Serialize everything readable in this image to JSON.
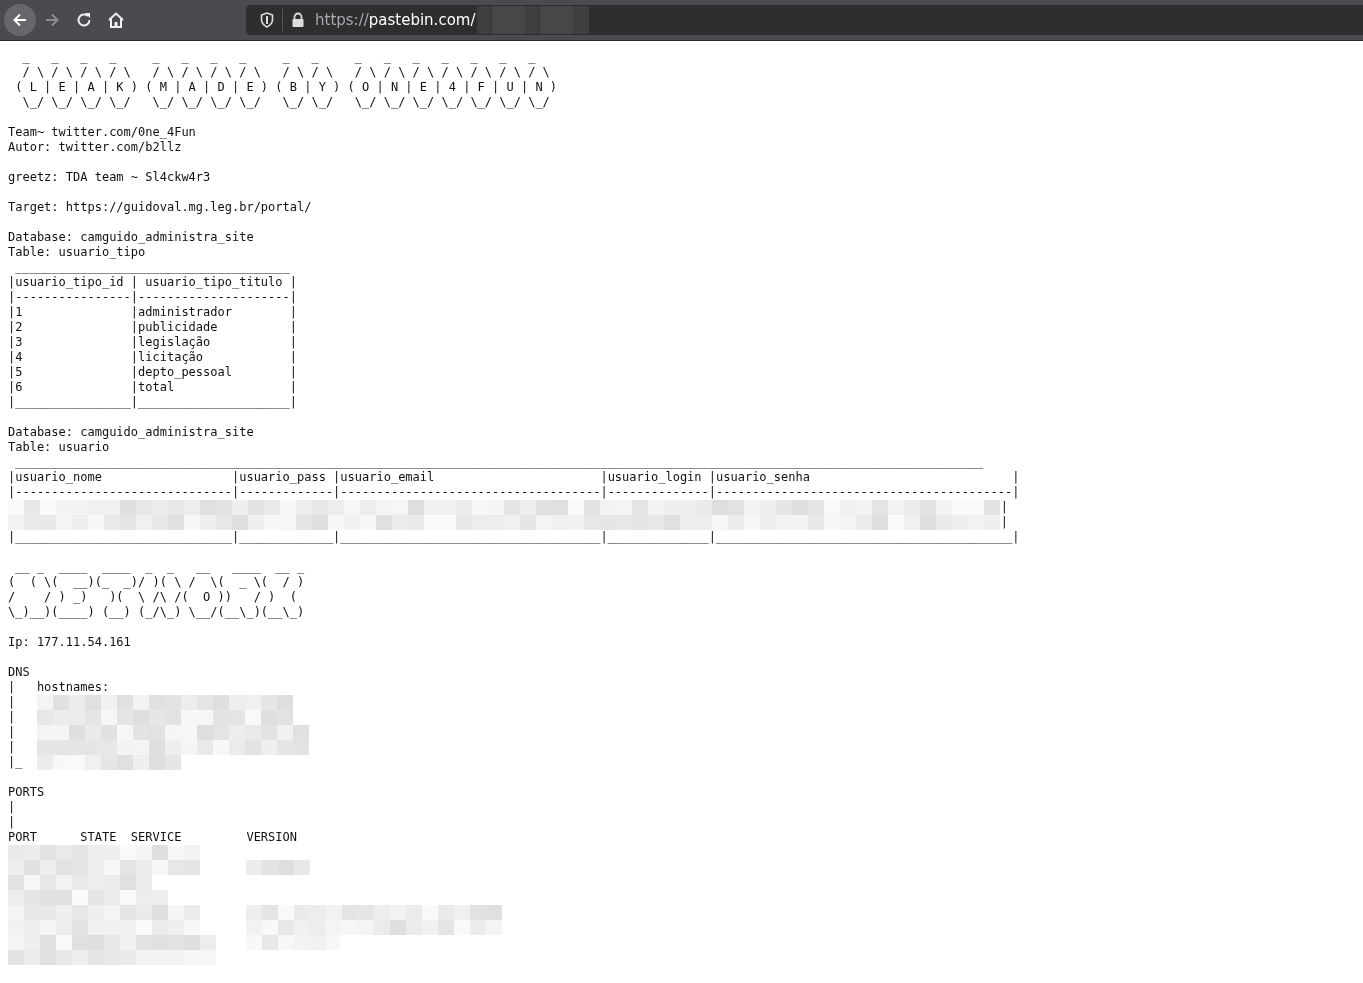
{
  "browser": {
    "url_scheme": "https://",
    "url_host": "pastebin.com/"
  },
  "lines": [
    {
      "kind": "art",
      "text": "  _   _   _   _     _   _   _   _     _   _     _   _   _   _   _   _   _"
    },
    {
      "kind": "art",
      "text": "  / \\ / \\ / \\ / \\   / \\ / \\ / \\ / \\   / \\ / \\   / \\ / \\ / \\ / \\ / \\ / \\ / \\"
    },
    {
      "kind": "art",
      "text": " ( L | E | A | K ) ( M | A | D | E ) ( B | Y ) ( O | N | E | 4 | F | U | N )"
    },
    {
      "kind": "art",
      "text": "  \\_/ \\_/ \\_/ \\_/   \\_/ \\_/ \\_/ \\_/   \\_/ \\_/   \\_/ \\_/ \\_/ \\_/ \\_/ \\_/ \\_/"
    },
    {
      "kind": "blank"
    },
    {
      "kind": "text",
      "text": "Team~ twitter.com/0ne_4Fun"
    },
    {
      "kind": "text",
      "text": "Autor: twitter.com/b2llz"
    },
    {
      "kind": "blank"
    },
    {
      "kind": "text",
      "text": "greetz: TDA team ~ Sl4ckw4r3"
    },
    {
      "kind": "blank"
    },
    {
      "kind": "text",
      "text": "Target: https://guidoval.mg.leg.br/portal/"
    },
    {
      "kind": "blank"
    },
    {
      "kind": "text",
      "text": "Database: camguido_administra_site"
    },
    {
      "kind": "text",
      "text": "Table: usuario_tipo"
    },
    {
      "kind": "text",
      "text": " ______________________________________"
    },
    {
      "kind": "text",
      "text": "|usuario_tipo_id | usuario_tipo_titulo |"
    },
    {
      "kind": "text",
      "text": "|----------------|---------------------|"
    },
    {
      "kind": "text",
      "text": "|1               |administrador        |"
    },
    {
      "kind": "text",
      "text": "|2               |publicidade          |"
    },
    {
      "kind": "text",
      "text": "|3               |legislação           |"
    },
    {
      "kind": "text",
      "text": "|4               |licitação            |"
    },
    {
      "kind": "text",
      "text": "|5               |depto_pessoal        |"
    },
    {
      "kind": "text",
      "text": "|6               |total                |"
    },
    {
      "kind": "text",
      "text": "|________________|_____________________|"
    },
    {
      "kind": "blank"
    },
    {
      "kind": "text",
      "text": "Database: camguido_administra_site"
    },
    {
      "kind": "text",
      "text": "Table: usuario"
    },
    {
      "kind": "text",
      "text": " ______________________________________________________________________________________________________________________________________"
    },
    {
      "kind": "text",
      "text": "|usuario_nome                  |usuario_pass |usuario_email                       |usuario_login |usuario_senha                            |"
    },
    {
      "kind": "text",
      "text": "|------------------------------|-------------|------------------------------------|--------------|-----------------------------------------|"
    },
    {
      "kind": "redacted",
      "suffix": "|"
    },
    {
      "kind": "redacted",
      "suffix": "|"
    },
    {
      "kind": "text",
      "text": "|______________________________|_____________|____________________________________|______________|_________________________________________|"
    },
    {
      "kind": "blank"
    },
    {
      "kind": "art",
      "text": " __ _  ____  ____  _  _   __   ____  __ _"
    },
    {
      "kind": "art",
      "text": "(  ( \\(  __)(_  _)/ )( \\ /  \\(  _ \\(  / )"
    },
    {
      "kind": "art",
      "text": "/    / ) _)   )(  \\ /\\ /(  O ))   / )  ("
    },
    {
      "kind": "art",
      "text": "\\_)__)(____) (__) (_/\\_) \\__/(__\\_)(__\\_)"
    },
    {
      "kind": "blank"
    },
    {
      "kind": "text",
      "text": "Ip: 177.11.54.161"
    },
    {
      "kind": "blank"
    },
    {
      "kind": "text",
      "text": "DNS"
    },
    {
      "kind": "text",
      "text": "|   hostnames:"
    },
    {
      "kind": "redacted",
      "prefix": "|"
    },
    {
      "kind": "redacted",
      "prefix": "|"
    },
    {
      "kind": "redacted",
      "prefix": "|"
    },
    {
      "kind": "redacted",
      "prefix": "|"
    },
    {
      "kind": "redacted",
      "prefix": "|_"
    },
    {
      "kind": "blank"
    },
    {
      "kind": "text",
      "text": "PORTS"
    },
    {
      "kind": "text",
      "text": "|"
    },
    {
      "kind": "text",
      "text": "|"
    },
    {
      "kind": "text",
      "text": "PORT      STATE  SERVICE         VERSION"
    },
    {
      "kind": "redacted"
    },
    {
      "kind": "redacted"
    },
    {
      "kind": "redacted"
    },
    {
      "kind": "redacted"
    },
    {
      "kind": "redacted"
    },
    {
      "kind": "redacted"
    },
    {
      "kind": "redacted"
    },
    {
      "kind": "redacted"
    }
  ]
}
